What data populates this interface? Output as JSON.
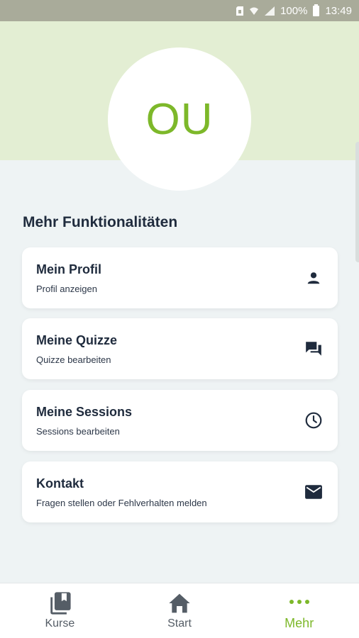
{
  "status_bar": {
    "battery": "100%",
    "time": "13:49"
  },
  "profile": {
    "initials": "OU",
    "accent_color": "#7db82a"
  },
  "section": {
    "title": "Mehr Funktionalitäten"
  },
  "cards": [
    {
      "title": "Mein Profil",
      "subtitle": "Profil anzeigen",
      "icon": "person-icon"
    },
    {
      "title": "Meine Quizze",
      "subtitle": "Quizze bearbeiten",
      "icon": "chat-icon"
    },
    {
      "title": "Meine Sessions",
      "subtitle": "Sessions bearbeiten",
      "icon": "clock-icon"
    },
    {
      "title": "Kontakt",
      "subtitle": "Fragen stellen oder Fehlverhalten melden",
      "icon": "mail-icon"
    }
  ],
  "bottom_nav": {
    "items": [
      {
        "label": "Kurse",
        "icon": "library-icon",
        "active": false
      },
      {
        "label": "Start",
        "icon": "home-icon",
        "active": false
      },
      {
        "label": "Mehr",
        "icon": "more-dots-icon",
        "active": true
      }
    ]
  }
}
